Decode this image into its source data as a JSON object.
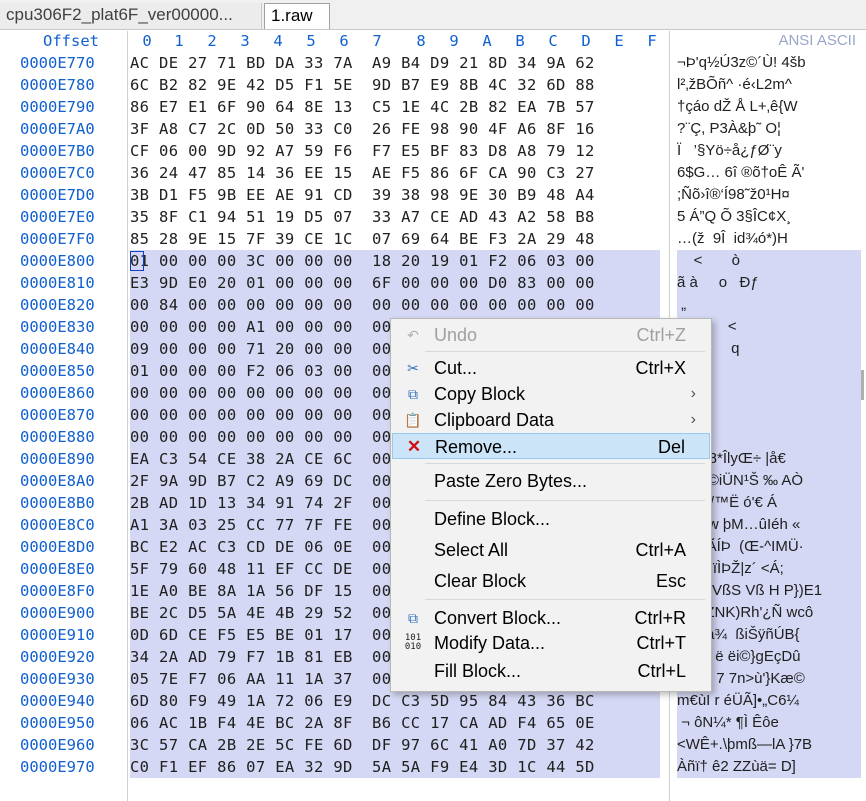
{
  "tabs": [
    {
      "label": "cpu306F2_plat6F_ver00000..."
    },
    {
      "label": "1.raw"
    }
  ],
  "header": {
    "offset": "Offset",
    "columns": [
      "0",
      "1",
      "2",
      "3",
      "4",
      "5",
      "6",
      "7",
      "8",
      "9",
      "A",
      "B",
      "C",
      "D",
      "E",
      "F"
    ],
    "ansi": "ANSI ASCII"
  },
  "rows": [
    {
      "off": "0000E770",
      "hex": "AC DE 27 71 BD DA 33 7A  A9 B4 D9 21 8D 34 9A 62",
      "ascii": "¬Þ'q½Ú3z©´Ù! 4šb"
    },
    {
      "off": "0000E780",
      "hex": "6C B2 82 9E 42 D5 F1 5E  9D B7 E9 8B 4C 32 6D 88",
      "ascii": "l²‚žBÕñ^ ·é‹L2m^"
    },
    {
      "off": "0000E790",
      "hex": "86 E7 E1 6F 90 64 8E 13  C5 1E 4C 2B 82 EA 7B 57",
      "ascii": "†çáo dŽ Å L+‚ê{W"
    },
    {
      "off": "0000E7A0",
      "hex": "3F A8 C7 2C 0D 50 33 C0  26 FE 98 90 4F A6 8F 16",
      "ascii": "?¨Ç, P3À&þ˜ O¦"
    },
    {
      "off": "0000E7B0",
      "hex": "CF 06 00 9D 92 A7 59 F6  F7 E5 BF 83 D8 A8 79 12",
      "ascii": "Ï   ’§Yö÷å¿ƒØ¨y"
    },
    {
      "off": "0000E7C0",
      "hex": "36 24 47 85 14 36 EE 15  AE F5 86 6F CA 90 C3 27",
      "ascii": "6$G… 6î ®õ†oÊ Ã'"
    },
    {
      "off": "0000E7D0",
      "hex": "3B D1 F5 9B EE AE 91 CD  39 38 98 9E 30 B9 48 A4",
      "ascii": ";Ñõ›î®‘Í98˜ž0¹H¤"
    },
    {
      "off": "0000E7E0",
      "hex": "35 8F C1 94 51 19 D5 07  33 A7 CE AD 43 A2 58 B8",
      "ascii": "5 Á”Q Õ 3§Î­C¢X¸"
    },
    {
      "off": "0000E7F0",
      "hex": "85 28 9E 15 7F 39 CE 1C  07 69 64 BE F3 2A 29 48",
      "ascii": "…(ž  9Î  id¾ó*)H"
    },
    {
      "off": "0000E800",
      "hex": "01 00 00 00 3C 00 00 00  18 20 19 01 F2 06 03 00",
      "ascii": "    <       ò   "
    },
    {
      "off": "0000E810",
      "hex": "E3 9D E0 20 01 00 00 00  6F 00 00 00 D0 83 00 00",
      "ascii": "ã à     o   Ðƒ  "
    },
    {
      "off": "0000E820",
      "hex": "00 84 00 00 00 00 00 00  00 00 00 00 00 00 00 00",
      "ascii": " „              "
    },
    {
      "off": "0000E830",
      "hex": "00 00 00 00 A1 00 00 00  00 00 00 00 00 00 00 00",
      "ascii": "    ¡       <   "
    },
    {
      "off": "0000E840",
      "hex": "09 00 00 00 71 20 00 00  00 00 00 00 00 00 00 00",
      "ascii": "    q       q   "
    },
    {
      "off": "0000E850",
      "hex": "01 00 00 00 F2 06 03 00  00 00 00 00 00 00 00 00",
      "ascii": "    ò           "
    },
    {
      "off": "0000E860",
      "hex": "00 00 00 00 00 00 00 00  00 00 00 00 00 00 00 00",
      "ascii": "                "
    },
    {
      "off": "0000E870",
      "hex": "00 00 00 00 00 00 00 00  00 00 00 00 00 00 00 00",
      "ascii": "                "
    },
    {
      "off": "0000E880",
      "hex": "00 00 00 00 00 00 00 00  00 00 00 00 00 00 00 00",
      "ascii": "                "
    },
    {
      "off": "0000E890",
      "hex": "EA C3 54 CE 38 2A CE 6C  00 00 00 00 00 00 00 00",
      "ascii": "êÃTÎ8*ÎlyŒ÷ |å€"
    },
    {
      "off": "0000E8A0",
      "hex": "2F 9A 9D B7 C2 A9 69 DC  00 00 00 00 00 00 00 00",
      "ascii": "/š ·Â©iÜN¹Š ‰ AÒ"
    },
    {
      "off": "0000E8B0",
      "hex": "2B AD 1D 13 34 91 74 2F  00 00 00 00 00 00 00 00",
      "ascii": "+­  4‘t/™Ë ó'€ Á"
    },
    {
      "off": "0000E8C0",
      "hex": "A1 3A 03 25 CC 77 7F FE  00 00 00 00 00 00 00 00",
      "ascii": "¡: %Ìw þM…ûIéh «"
    },
    {
      "off": "0000E8D0",
      "hex": "BC E2 AC C3 CD DE 06 0E  00 00 00 00 00 00 00 00",
      "ascii": "¼â¬ÃÍÞ  (Œ-^IMÜ·"
    },
    {
      "off": "0000E8E0",
      "hex": "5F 79 60 48 11 EF CC DE  00 00 00 00 00 00 00 00",
      "ascii": "_y`H ïÌÞŽ|z´ <Á;"
    },
    {
      "off": "0000E8F0",
      "hex": "1E A0 BE 8A 1A 56 DF 15  00 00 00 00 00 00 00 00",
      "ascii": "  ¾Š VßS Vß H P})E1"
    },
    {
      "off": "0000E900",
      "hex": "BE 2C D5 5A 4E 4B 29 52  00 00 00 00 00 00 00 00",
      "ascii": "¾,ÕZNK)Rh'¿Ñ wcô"
    },
    {
      "off": "0000E910",
      "hex": "0D 6D CE F5 E5 BE 01 17  00 00 00 00 00 00 00 00",
      "ascii": " mÎõå¾  ßiŠÿñÚB{"
    },
    {
      "off": "0000E920",
      "hex": "34 2A AD 79 F7 1B 81 EB  00 00 00 00 00 00 00 00",
      "ascii": "4*­y÷  ë ëi©}gEçDû"
    },
    {
      "off": "0000E930",
      "hex": "05 7E F7 06 AA 11 1A 37  00 00 00 00 00 00 00 00",
      "ascii": " ~÷ ª  7 7n>ù'}Kæ©"
    },
    {
      "off": "0000E940",
      "hex": "6D 80 F9 49 1A 72 06 E9  DC C3 5D 95 84 43 36 BC",
      "ascii": "m€ùI r éÜÃ]•„C6¼"
    },
    {
      "off": "0000E950",
      "hex": "06 AC 1B F4 4E BC 2A 8F  B6 CC 17 CA AD F4 65 0E",
      "ascii": " ¬ ôN¼* ¶Ì Ê­ôe "
    },
    {
      "off": "0000E960",
      "hex": "3C 57 CA 2B 2E 5C FE 6D  DF 97 6C 41 A0 7D 37 42",
      "ascii": "<WÊ+.\\þmß—lA }7B"
    },
    {
      "off": "0000E970",
      "hex": "C0 F1 EF 86 07 EA 32 9D  5A 5A F9 E4 3D 1C 44 5D",
      "ascii": "Àñï† ê2 ZZùä= D]"
    }
  ],
  "menu": {
    "items": [
      {
        "label": "Undo",
        "key": "Ctrl+Z",
        "icon": "undo-icon"
      },
      {
        "label": "Cut...",
        "key": "Ctrl+X",
        "icon": "scissors-icon"
      },
      {
        "label": "Copy Block",
        "key": "",
        "icon": "copy-icon"
      },
      {
        "label": "Clipboard Data",
        "key": "",
        "icon": "clipboard-icon"
      },
      {
        "label": "Remove...",
        "key": "Del",
        "icon": "remove-x-icon"
      },
      {
        "label": "Paste Zero Bytes...",
        "key": ""
      },
      {
        "label": "Define Block...",
        "key": ""
      },
      {
        "label": "Select All",
        "key": "Ctrl+A"
      },
      {
        "label": "Clear Block",
        "key": "Esc"
      },
      {
        "label": "Convert Block...",
        "key": "Ctrl+R",
        "icon": "convert-icon"
      },
      {
        "label": "Modify Data...",
        "key": "Ctrl+T",
        "icon": "modify-data-icon"
      },
      {
        "label": "Fill Block...",
        "key": "Ctrl+L"
      }
    ]
  },
  "colors": {
    "offset_blue": "#1060d0",
    "selection": "#d4d8f4",
    "menu_highlight": "#cce4f7",
    "remove_red": "#d01010"
  }
}
